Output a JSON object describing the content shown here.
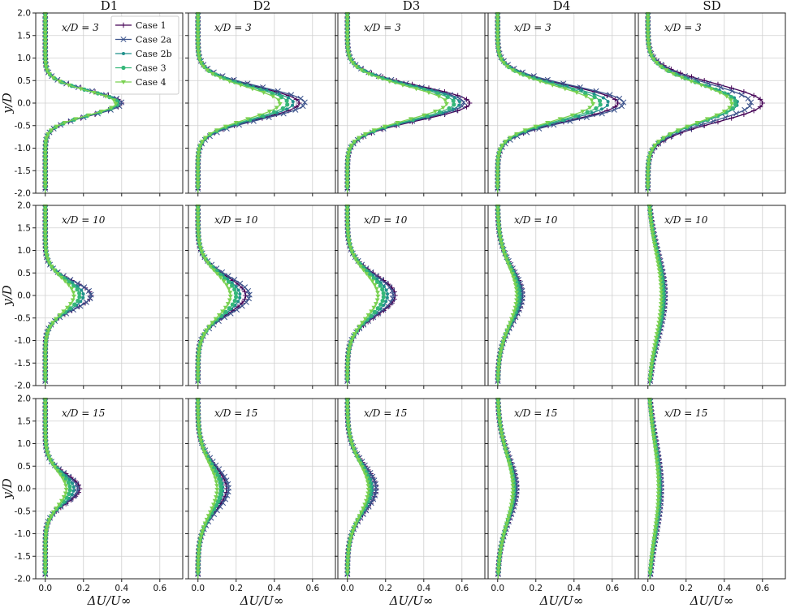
{
  "chart_data": {
    "type": "line",
    "layout": "grid 3x5",
    "column_titles": [
      "D1",
      "D2",
      "D3",
      "D4",
      "SD"
    ],
    "row_annotations": [
      "x/D = 3",
      "x/D = 10",
      "x/D = 15"
    ],
    "xlabel": "ΔU/U∞",
    "ylabel": "y/D",
    "xlim": [
      -0.05,
      0.72
    ],
    "ylim": [
      -2.0,
      2.0
    ],
    "xticks": [
      "0.0",
      "0.2",
      "0.4",
      "0.6"
    ],
    "xtick_values": [
      0.0,
      0.2,
      0.4,
      0.6
    ],
    "yticks": [
      "-2.0",
      "-1.5",
      "-1.0",
      "-0.5",
      "0.0",
      "0.5",
      "1.0",
      "1.5",
      "2.0"
    ],
    "ytick_values": [
      -2.0,
      -1.5,
      -1.0,
      -0.5,
      0.0,
      0.5,
      1.0,
      1.5,
      2.0
    ],
    "grid": true,
    "legend_location": "upper right of D1, x/D = 3 panel",
    "series": [
      {
        "name": "Case 1",
        "color": "#440154",
        "marker": "plus"
      },
      {
        "name": "Case 2a",
        "color": "#3b528b",
        "marker": "x"
      },
      {
        "name": "Case 2b",
        "color": "#21918c",
        "marker": "dot"
      },
      {
        "name": "Case 3",
        "color": "#35b779",
        "marker": "circle"
      },
      {
        "name": "Case 4",
        "color": "#7ad151",
        "marker": "triangle-down"
      }
    ],
    "panels": [
      {
        "row": 0,
        "col": 0,
        "peak": [
          0.4,
          0.4,
          0.385,
          0.38,
          0.37
        ],
        "width": [
          0.27,
          0.27,
          0.27,
          0.27,
          0.27
        ]
      },
      {
        "row": 0,
        "col": 1,
        "peak": [
          0.53,
          0.56,
          0.5,
          0.47,
          0.43
        ],
        "width": [
          0.35,
          0.35,
          0.35,
          0.35,
          0.35
        ]
      },
      {
        "row": 0,
        "col": 2,
        "peak": [
          0.64,
          0.61,
          0.59,
          0.56,
          0.52
        ],
        "width": [
          0.37,
          0.37,
          0.37,
          0.37,
          0.37
        ]
      },
      {
        "row": 0,
        "col": 3,
        "peak": [
          0.63,
          0.66,
          0.58,
          0.54,
          0.5
        ],
        "width": [
          0.38,
          0.38,
          0.38,
          0.38,
          0.38
        ]
      },
      {
        "row": 0,
        "col": 4,
        "peak": [
          0.6,
          0.54,
          0.47,
          0.46,
          0.44
        ],
        "width": [
          0.42,
          0.42,
          0.42,
          0.42,
          0.42
        ]
      },
      {
        "row": 1,
        "col": 0,
        "peak": [
          0.24,
          0.24,
          0.2,
          0.18,
          0.15
        ],
        "width": [
          0.32,
          0.32,
          0.34,
          0.35,
          0.37
        ]
      },
      {
        "row": 1,
        "col": 1,
        "peak": [
          0.25,
          0.27,
          0.22,
          0.2,
          0.17
        ],
        "width": [
          0.42,
          0.42,
          0.44,
          0.45,
          0.47
        ]
      },
      {
        "row": 1,
        "col": 2,
        "peak": [
          0.25,
          0.24,
          0.21,
          0.19,
          0.16
        ],
        "width": [
          0.45,
          0.45,
          0.47,
          0.48,
          0.5
        ]
      },
      {
        "row": 1,
        "col": 3,
        "peak": [
          0.13,
          0.13,
          0.12,
          0.11,
          0.1
        ],
        "width": [
          0.6,
          0.6,
          0.62,
          0.63,
          0.65
        ]
      },
      {
        "row": 1,
        "col": 4,
        "peak": [
          0.09,
          0.09,
          0.085,
          0.08,
          0.07
        ],
        "width": [
          0.95,
          0.95,
          0.95,
          0.95,
          0.95
        ]
      },
      {
        "row": 2,
        "col": 0,
        "peak": [
          0.18,
          0.17,
          0.15,
          0.13,
          0.11
        ],
        "width": [
          0.33,
          0.33,
          0.35,
          0.36,
          0.38
        ]
      },
      {
        "row": 2,
        "col": 1,
        "peak": [
          0.15,
          0.16,
          0.13,
          0.12,
          0.1
        ],
        "width": [
          0.5,
          0.5,
          0.52,
          0.53,
          0.55
        ]
      },
      {
        "row": 2,
        "col": 2,
        "peak": [
          0.15,
          0.15,
          0.13,
          0.12,
          0.11
        ],
        "width": [
          0.52,
          0.52,
          0.54,
          0.55,
          0.57
        ]
      },
      {
        "row": 2,
        "col": 3,
        "peak": [
          0.1,
          0.1,
          0.09,
          0.085,
          0.08
        ],
        "width": [
          0.7,
          0.7,
          0.72,
          0.73,
          0.75
        ]
      },
      {
        "row": 2,
        "col": 4,
        "peak": [
          0.07,
          0.07,
          0.065,
          0.06,
          0.055
        ],
        "width": [
          1.05,
          1.05,
          1.05,
          1.05,
          1.05
        ]
      }
    ]
  }
}
